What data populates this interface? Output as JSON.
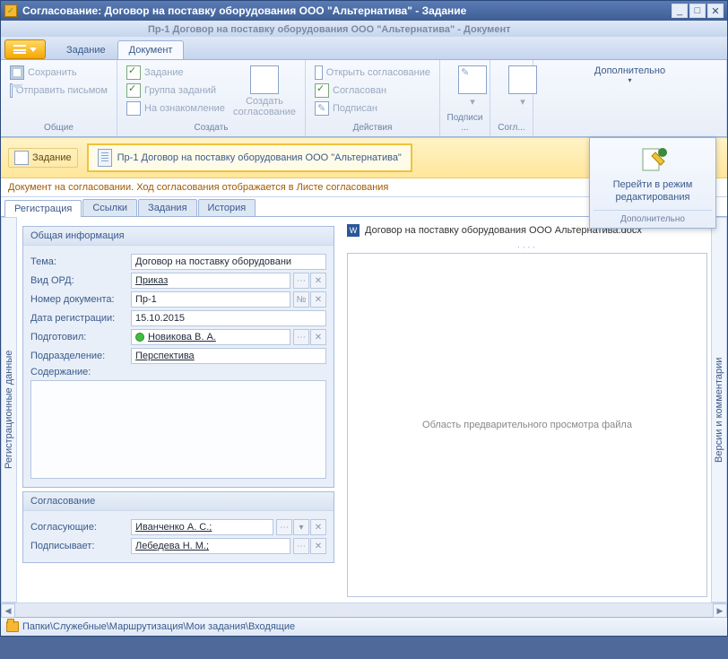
{
  "window": {
    "title": "Согласование: Договор на поставку оборудования ООО \"Альтернатива\" - Задание",
    "subtitle": "Пр-1 Договор на поставку оборудования ООО \"Альтернатива\" - Документ"
  },
  "main_tabs": {
    "task": "Задание",
    "document": "Документ"
  },
  "ribbon": {
    "common": {
      "title": "Общие",
      "save": "Сохранить",
      "send_mail": "Отправить письмом"
    },
    "create": {
      "title": "Создать",
      "task": "Задание",
      "task_group": "Группа заданий",
      "acquaint": "На ознакомление",
      "create_approval_l1": "Создать",
      "create_approval_l2": "согласование"
    },
    "actions": {
      "title": "Действия",
      "open_approval": "Открыть согласование",
      "approved": "Согласован",
      "signed": "Подписан"
    },
    "signatures": {
      "title": "Подписи ..."
    },
    "approval_short": {
      "title": "Согл..."
    },
    "extra": {
      "title": "Дополнительно"
    }
  },
  "doc_strip": {
    "task_btn": "Задание",
    "doc_label": "Пр-1 Договор на поставку оборудования ООО \"Альтернатива\""
  },
  "dropdown": {
    "line1": "Перейти в режим",
    "line2": "редактирования",
    "footer": "Дополнительно"
  },
  "status_line": "Документ на согласовании. Ход согласования отображается в Листе согласования",
  "inner_tabs": {
    "reg": "Регистрация",
    "links": "Ссылки",
    "tasks": "Задания",
    "history": "История"
  },
  "left_panel": "Регистрационные данные",
  "right_panel": "Версии и комментарии",
  "section_general": {
    "title": "Общая информация",
    "topic_label": "Тема:",
    "topic_value": "Договор на поставку оборудовани",
    "ord_label": "Вид ОРД:",
    "ord_value": "Приказ",
    "number_label": "Номер документа:",
    "number_value": "Пр-1",
    "date_label": "Дата регистрации:",
    "date_value": "15.10.2015",
    "author_label": "Подготовил:",
    "author_value": "Новикова В. А.",
    "dept_label": "Подразделение:",
    "dept_value": "Перспектива",
    "content_label": "Содержание:"
  },
  "section_approval": {
    "title": "Согласование",
    "approvers_label": "Согласующие:",
    "approvers_value": "Иванченко А. С.;",
    "signer_label": "Подписывает:",
    "signer_value": "Лебедева Н. М.;"
  },
  "preview": {
    "filename": "Договор на поставку оборудования ООО Альтернатива.docx",
    "placeholder": "Область предварительного просмотра файла"
  },
  "footer_path": "Папки\\Служебные\\Маршрутизация\\Мои задания\\Входящие"
}
